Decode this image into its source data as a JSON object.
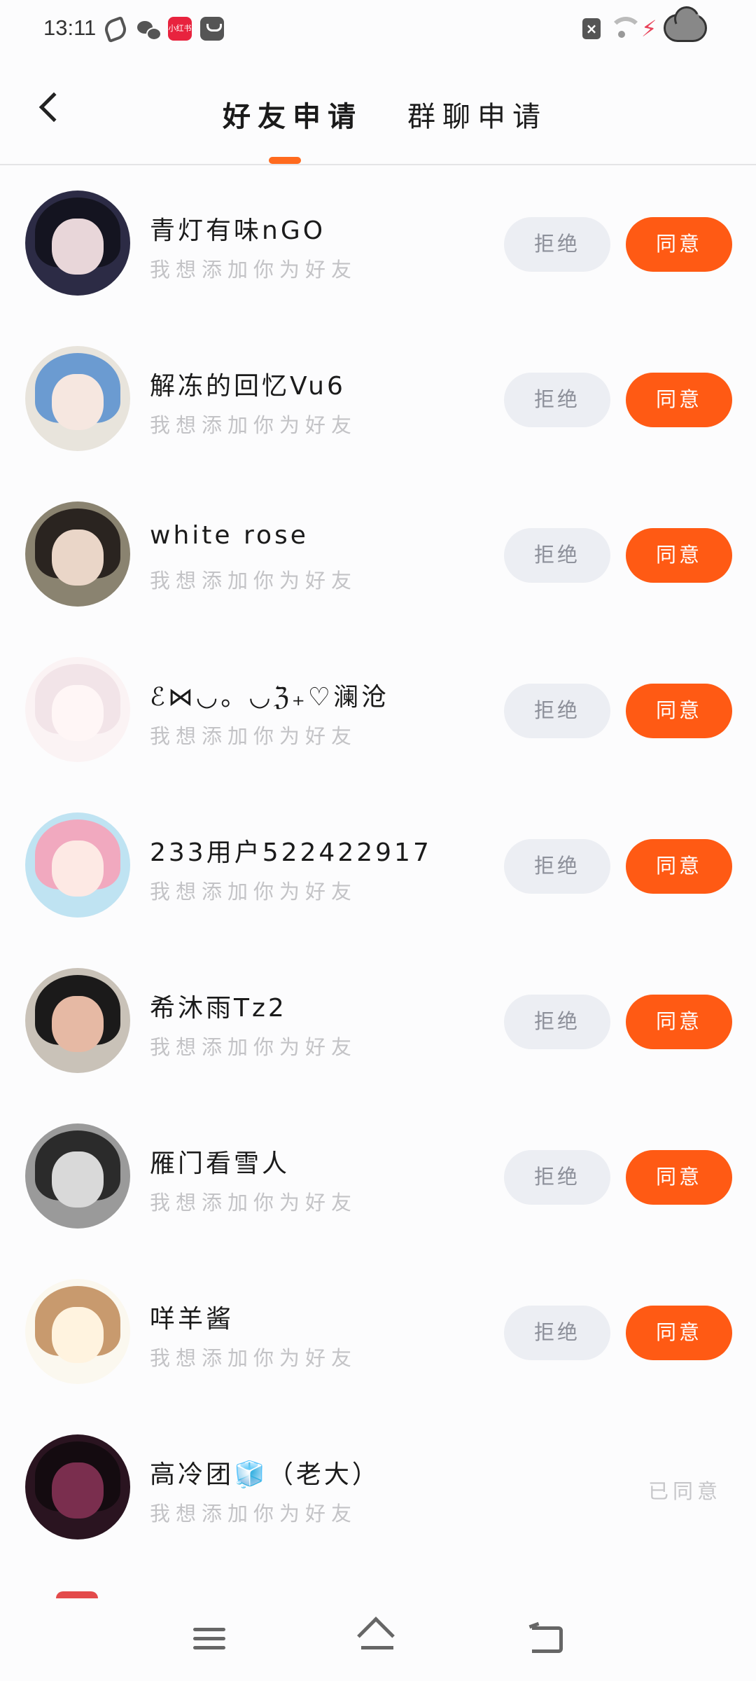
{
  "status_bar": {
    "time": "13:11",
    "notification_icons": [
      "leaf-icon",
      "wechat-icon",
      "redbook-icon",
      "bag-icon"
    ],
    "badge_text": "小红书",
    "system_icons": [
      "sim-disabled-icon",
      "wifi-icon",
      "charging-icon",
      "cloud-icon"
    ]
  },
  "header": {
    "tabs": [
      {
        "label": "好友申请",
        "active": true
      },
      {
        "label": "群聊申请",
        "active": false
      }
    ],
    "accent_color": "#ff6a1e"
  },
  "requests": [
    {
      "name": "青灯有味nGO",
      "message": "我想添加你为好友",
      "status": "pending",
      "avatar": "anime-girl-black-hair"
    },
    {
      "name": "解冻的回忆Vu6",
      "message": "我想添加你为好友",
      "status": "pending",
      "avatar": "anime-girl-blue-hair"
    },
    {
      "name": "white rose",
      "message": "我想添加你为好友",
      "status": "pending",
      "avatar": "girl-photo"
    },
    {
      "name": "ℰ⋈◡。◡ℨ₊♡澜沧",
      "message": "我想添加你为好友",
      "status": "pending",
      "avatar": "anime-girl-white-hair"
    },
    {
      "name": "233用户522422917",
      "message": "我想添加你为好友",
      "status": "pending",
      "avatar": "anime-girl-sky"
    },
    {
      "name": "希沐雨Tz2",
      "message": "我想添加你为好友",
      "status": "pending",
      "avatar": "couple-photo"
    },
    {
      "name": "雁门看雪人",
      "message": "我想添加你为好友",
      "status": "pending",
      "avatar": "monochrome-girl"
    },
    {
      "name": "咩羊酱",
      "message": "我想添加你为好友",
      "status": "pending",
      "avatar": "chibi-bear-hat"
    },
    {
      "name": "高冷团🧊（老大）",
      "message": "我想添加你为好友",
      "status": "accepted",
      "avatar": "dark-anime-girl"
    }
  ],
  "actions": {
    "reject_label": "拒绝",
    "accept_label": "同意",
    "accepted_label": "已同意"
  },
  "colors": {
    "accept_button": "#ff5a14",
    "reject_button": "#eceef3",
    "subtitle_text": "#c3c3c6"
  },
  "nav_bar": {
    "icons": [
      "menu-icon",
      "home-icon",
      "back-icon"
    ]
  }
}
